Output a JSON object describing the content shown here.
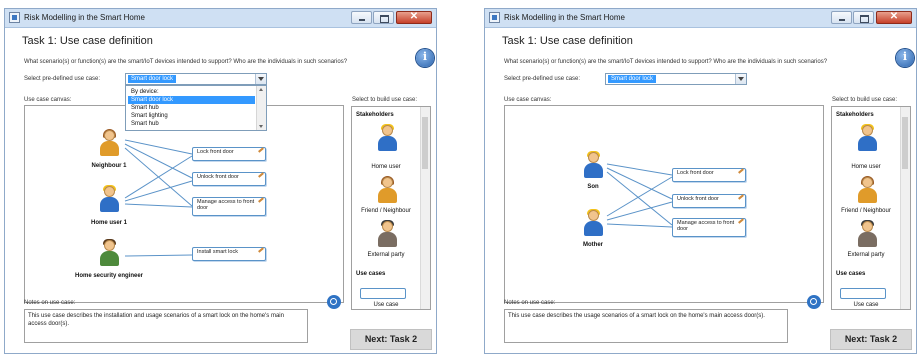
{
  "window": {
    "title": "Risk Modelling in the Smart Home",
    "close_glyph": "✕"
  },
  "task": {
    "title": "Task 1: Use case definition",
    "question": "What scenario(s) or function(s) are the smart/IoT devices intended to support? Who are the individuals in such scenarios?",
    "select_label": "Select pre-defined use case:",
    "help_glyph": "i"
  },
  "left": {
    "select_value": "Smart door lock",
    "dropdown": [
      "By device:",
      "Smart door lock",
      "Smart hub",
      "Smart lighting",
      "Smart hub"
    ],
    "actors": [
      "Neighbour 1",
      "Home user 1",
      "Home security engineer"
    ],
    "use_cases": [
      "Lock front door",
      "Unlock front door",
      "Manage access to front door",
      "Install smart lock"
    ],
    "notes": "This use case describes the installation and usage scenarios of a smart lock on the home's main access door(s)."
  },
  "right": {
    "select_value": "Smart door lock",
    "actors": [
      "Son",
      "Mother"
    ],
    "use_cases": [
      "Lock front door",
      "Unlock front door",
      "Manage access to front door"
    ],
    "notes": "This use case describes the usage scenarios of a smart lock on the home's main access door(s)."
  },
  "labels": {
    "canvas": "Use case canvas:",
    "build": "Select to build use case:",
    "notes": "Notes on use case:"
  },
  "toolbox": {
    "stakeholders_heading": "Stakeholders",
    "left_stakeholders": [
      "Home user",
      "Friend / Neighbour",
      "External party"
    ],
    "right_stakeholders": [
      "Home user",
      "Friend / Neighbour",
      "External party"
    ],
    "use_cases_heading": "Use cases",
    "use_case_item": "Use case"
  },
  "buttons": {
    "next": "Next: Task 2"
  },
  "icons": {
    "help": "info-icon",
    "zoom": "search-icon",
    "minimize": "minimize-icon",
    "maximize": "maximize-icon",
    "close": "close-icon"
  }
}
